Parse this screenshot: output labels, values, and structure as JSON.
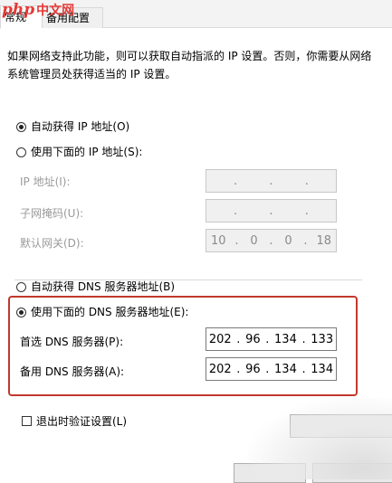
{
  "logo": {
    "mark": "php",
    "site": "中文网"
  },
  "tabs": [
    {
      "label": "常规"
    },
    {
      "label": "备用配置"
    }
  ],
  "description": "如果网络支持此功能，则可以获取自动指派的 IP 设置。否则，你需要从网络系统管理员处获得适当的 IP 设置。",
  "ip": {
    "auto_label": "自动获得 IP 地址(O)",
    "manual_label": "使用下面的 IP 地址(S):",
    "auto_selected": true,
    "fields": {
      "ip_label": "IP 地址(I):",
      "ip_value": [
        "",
        "",
        "",
        ""
      ],
      "mask_label": "子网掩码(U):",
      "mask_value": [
        "",
        "",
        "",
        ""
      ],
      "gateway_label": "默认网关(D):",
      "gateway_value": [
        "10",
        "0",
        "0",
        "18"
      ]
    }
  },
  "dns": {
    "auto_label": "自动获得 DNS 服务器地址(B)",
    "manual_label": "使用下面的 DNS 服务器地址(E):",
    "manual_selected": true,
    "preferred_label": "首选 DNS 服务器(P):",
    "preferred_value": [
      "202",
      "96",
      "134",
      "133"
    ],
    "alternate_label": "备用 DNS 服务器(A):",
    "alternate_value": [
      "202",
      "96",
      "134",
      "134"
    ]
  },
  "validate_label": "退出时验证设置(L)",
  "validate_checked": false,
  "colors": {
    "highlight": "#c0392b",
    "logo": "#e53935"
  }
}
